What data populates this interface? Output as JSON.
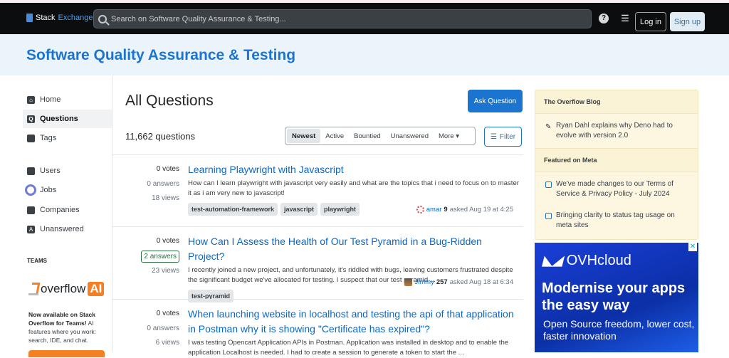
{
  "header": {
    "logo_a": "Stack",
    "logo_b": "Exchange",
    "search_placeholder": "Search on Software Quality Assurance & Testing...",
    "login": "Log in",
    "signup": "Sign up"
  },
  "site_title": "Software Quality Assurance & Testing",
  "sidebar": {
    "items": [
      {
        "label": "Home"
      },
      {
        "label": "Questions"
      },
      {
        "label": "Tags"
      },
      {
        "label": "Users"
      },
      {
        "label": "Jobs"
      },
      {
        "label": "Companies"
      },
      {
        "label": "Unanswered"
      }
    ],
    "teams_label": "TEAMS",
    "oai_text": "overflow",
    "oai_badge": "AI",
    "teams_bold": "Now available on Stack Overflow for Teams!",
    "teams_desc": " AI features where you work: search, IDE, and chat."
  },
  "main": {
    "title": "All Questions",
    "ask": "Ask Question",
    "count": "11,662 questions",
    "tabs": [
      "Newest",
      "Active",
      "Bountied",
      "Unanswered",
      "More"
    ],
    "filter": "Filter",
    "questions": [
      {
        "votes": "0 votes",
        "answers": "0 answers",
        "views": "18 views",
        "title": "Learning Playwright with Javascript",
        "excerpt": "How can I learn playwright with javascript very easily and what are the topics that i need to focus on to master it as i am very new to javascript!",
        "tags": [
          "test-automation-framework",
          "javascript",
          "playwright"
        ],
        "user": "amar",
        "rep": "9",
        "asked": "asked Aug 19 at 4:25"
      },
      {
        "votes": "0 votes",
        "answers": "2 answers",
        "views": "23 views",
        "title": "How Can I Assess the Health of Our Test Pyramid in a Bug-Ridden Project?",
        "excerpt": "I recently joined a new project, and unfortunately, it's riddled with bugs, leaving customers frustrated despite the significant budget we've allocated for testing. I suspect that our test pyramid ...",
        "tags": [
          "test-pyramid"
        ],
        "user": "Jimmy",
        "rep": "257",
        "asked": "asked Aug 18 at 6:34"
      },
      {
        "votes": "0 votes",
        "answers": "0 answers",
        "views": "6 views",
        "title": "When launching website in localhost and testing the api of that application in Postman why it is showing \"Certificate has expired\"?",
        "excerpt": "I was testing Opencart Application APIs in Postman. Application was installed in desktop and to enable the application Localhost is needed. I had to create a session to generate a token to start the ..."
      }
    ]
  },
  "blog": {
    "title": "The Overflow Blog",
    "item": "Ryan Dahl explains why Deno had to evolve with version 2.0",
    "meta_title": "Featured on Meta",
    "meta_items": [
      "We've made changes to our Terms of Service & Privacy Policy - July 2024",
      "Bringing clarity to status tag usage on meta sites"
    ]
  },
  "ad": {
    "brand": "OVHcloud",
    "headline": "Modernise your apps the easy way",
    "sub": "Open Source freedom, lower cost, faster innovation"
  }
}
